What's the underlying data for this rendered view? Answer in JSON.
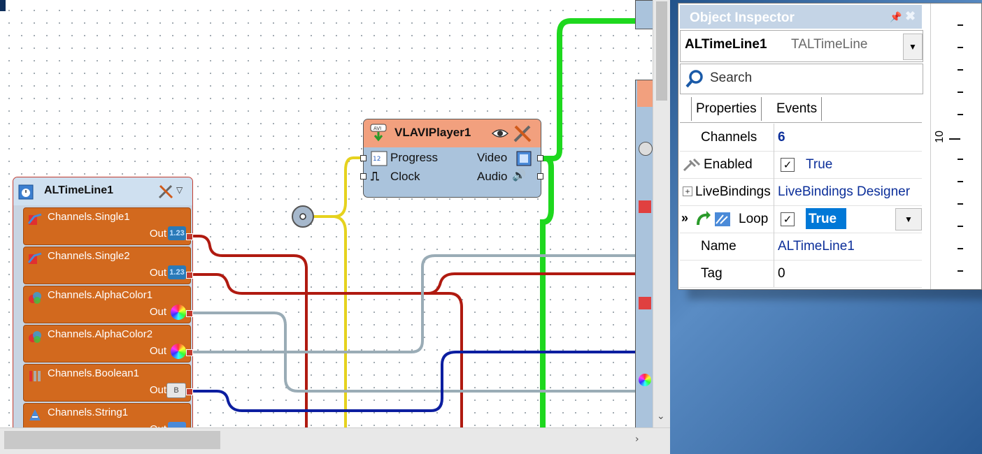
{
  "designer": {
    "timeline": {
      "title": "ALTimeLine1",
      "channels": [
        {
          "label": "Channels.Single1",
          "out": "Out",
          "badge": "1.23",
          "type": "single"
        },
        {
          "label": "Channels.Single2",
          "out": "Out",
          "badge": "1.23",
          "type": "single"
        },
        {
          "label": "Channels.AlphaColor1",
          "out": "Out",
          "badge": "",
          "type": "color"
        },
        {
          "label": "Channels.AlphaColor2",
          "out": "Out",
          "badge": "",
          "type": "color"
        },
        {
          "label": "Channels.Boolean1",
          "out": "Out",
          "badge": "B",
          "type": "boolean"
        },
        {
          "label": "Channels.String1",
          "out": "Out",
          "badge": "",
          "type": "string"
        }
      ]
    },
    "player": {
      "title": "VLAVIPlayer1",
      "inputs": [
        "Progress",
        "Clock"
      ],
      "outputs": [
        "Video",
        "Audio"
      ]
    },
    "wire_colors": {
      "green": "#1ed81e",
      "yellow": "#e6d21e",
      "red": "#b01a10",
      "blue": "#0c1ea0",
      "gray": "#9aacb6",
      "navy": "#0e2f5c"
    }
  },
  "inspector": {
    "title": "Object Inspector",
    "object_name": "ALTimeLine1",
    "object_type": "TALTimeLine",
    "search_placeholder": "Search",
    "tabs": [
      "Properties",
      "Events"
    ],
    "properties": [
      {
        "name": "Channels",
        "value": "6",
        "kind": "bold"
      },
      {
        "name": "Enabled",
        "value": "True",
        "kind": "check"
      },
      {
        "name": "LiveBindings",
        "value": "LiveBindings Designer",
        "kind": "link",
        "expandable": true
      },
      {
        "name": "Loop",
        "value": "True",
        "kind": "check-selected",
        "current": true
      },
      {
        "name": "Name",
        "value": "ALTimeLine1",
        "kind": "link"
      },
      {
        "name": "Tag",
        "value": "0",
        "kind": "plain"
      }
    ],
    "ruler_label": "10"
  },
  "icons": {
    "timeline": "timeline-icon",
    "tools": "tools-icon",
    "eye": "eye-icon",
    "search": "search-icon",
    "pin": "pin-icon",
    "close": "close-icon"
  }
}
